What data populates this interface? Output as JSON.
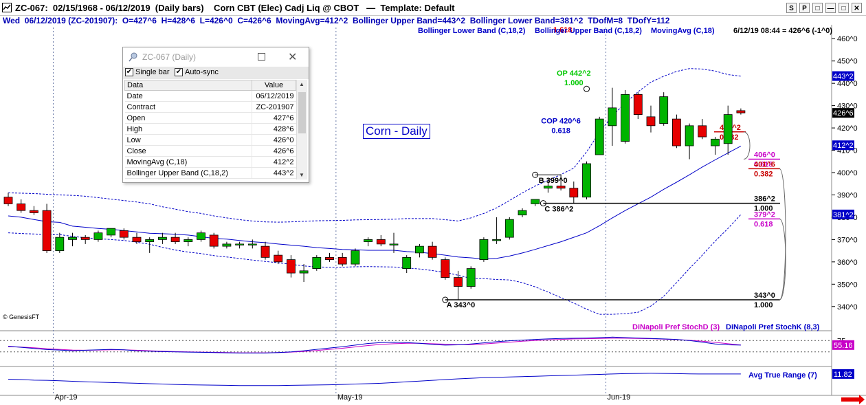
{
  "window": {
    "title": "ZC-067:  02/15/1968 - 06/12/2019  (Daily bars)    Corn CBT (Elec) Cadj Liq @ CBOT   —  Template: Default",
    "buttons": [
      "S",
      "P",
      "□",
      "—",
      "□",
      "✕"
    ]
  },
  "infobar": "Wed  06/12/2019 (ZC-201907):  O=427^6  H=428^6  L=426^0  C=426^6  MovingAvg=412^2  Bollinger Upper Band=443^2  Bollinger Lower Band=381^2  TDofM=8  TDofY=112",
  "legend": {
    "lower_band": "Bollinger Lower Band (C,18,2)",
    "upper_band": "Bollinger Upper Band (C,18,2)",
    "moving_avg": "MovingAvg (C,18)",
    "timestamp": "6/12/19 08:44 = 426^6 (-1^0)",
    "upper_band_overlap": "1.618"
  },
  "annotation": "Corn - Daily",
  "copyright": "© GenesisFT",
  "data_panel": {
    "title": "ZC-067 (Daily)",
    "single_bar_label": "Single bar",
    "auto_sync_label": "Auto-sync",
    "single_bar_checked": true,
    "auto_sync_checked": true,
    "header_label": "Data",
    "header_value": "Value",
    "rows": [
      {
        "label": "Date",
        "value": "06/12/2019"
      },
      {
        "label": "Contract",
        "value": "ZC-201907"
      },
      {
        "label": "Open",
        "value": "427^6"
      },
      {
        "label": "High",
        "value": "428^6"
      },
      {
        "label": "Low",
        "value": "426^0"
      },
      {
        "label": "Close",
        "value": "426^6"
      },
      {
        "label": "MovingAvg (C,18)",
        "value": "412^2"
      },
      {
        "label": "Bollinger Upper Band (C,18,2)",
        "value": "443^2"
      }
    ]
  },
  "price_axis": {
    "ticks": [
      "460^0",
      "450^0",
      "440^0",
      "430^0",
      "420^0",
      "410^0",
      "400^0",
      "390^0",
      "380^0",
      "370^0",
      "360^0",
      "350^0",
      "340^0"
    ],
    "markers": [
      {
        "label": "443^2",
        "value": 443.25,
        "color": "#0000c8"
      },
      {
        "label": "426^6",
        "value": 426.75,
        "color": "#000000"
      },
      {
        "label": "412^2",
        "value": 412.25,
        "color": "#0000c8"
      },
      {
        "label": "381^2",
        "value": 381.25,
        "color": "#0000c8"
      }
    ]
  },
  "x_axis": {
    "labels": [
      "Apr-19",
      "May-19",
      "Jun-19"
    ]
  },
  "chart_data": {
    "type": "candlestick",
    "title": "Corn CBT (Elec) Cadj Liq @ CBOT",
    "ylim": [
      335,
      465
    ],
    "x_labels": [
      "Apr-19",
      "May-19",
      "Jun-19"
    ],
    "candles": [
      {
        "o": 389,
        "h": 391,
        "l": 385,
        "c": 386
      },
      {
        "o": 386,
        "h": 388,
        "l": 382,
        "c": 383
      },
      {
        "o": 383,
        "h": 385,
        "l": 381,
        "c": 382
      },
      {
        "o": 383,
        "h": 386,
        "l": 364,
        "c": 365
      },
      {
        "o": 365,
        "h": 373,
        "l": 364,
        "c": 371
      },
      {
        "o": 370,
        "h": 373,
        "l": 367,
        "c": 371
      },
      {
        "o": 371,
        "h": 372,
        "l": 368,
        "c": 370
      },
      {
        "o": 370,
        "h": 374,
        "l": 369,
        "c": 373
      },
      {
        "o": 372,
        "h": 375,
        "l": 371,
        "c": 375
      },
      {
        "o": 374,
        "h": 375,
        "l": 370,
        "c": 371
      },
      {
        "o": 371,
        "h": 373,
        "l": 368,
        "c": 369
      },
      {
        "o": 369,
        "h": 371,
        "l": 364,
        "c": 370
      },
      {
        "o": 370,
        "h": 373,
        "l": 368,
        "c": 371
      },
      {
        "o": 371,
        "h": 373,
        "l": 368,
        "c": 369
      },
      {
        "o": 369,
        "h": 371,
        "l": 367,
        "c": 370
      },
      {
        "o": 370,
        "h": 374,
        "l": 369,
        "c": 373
      },
      {
        "o": 372,
        "h": 373,
        "l": 366,
        "c": 367
      },
      {
        "o": 367,
        "h": 369,
        "l": 366,
        "c": 368
      },
      {
        "o": 368,
        "h": 369,
        "l": 366,
        "c": 368
      },
      {
        "o": 368,
        "h": 370,
        "l": 366,
        "c": 368
      },
      {
        "o": 367,
        "h": 369,
        "l": 361,
        "c": 362
      },
      {
        "o": 363,
        "h": 365,
        "l": 359,
        "c": 360
      },
      {
        "o": 361,
        "h": 363,
        "l": 353,
        "c": 355
      },
      {
        "o": 355,
        "h": 359,
        "l": 351,
        "c": 356
      },
      {
        "o": 357,
        "h": 363,
        "l": 356,
        "c": 362
      },
      {
        "o": 362,
        "h": 364,
        "l": 360,
        "c": 361
      },
      {
        "o": 362,
        "h": 364,
        "l": 358,
        "c": 359
      },
      {
        "o": 359,
        "h": 366,
        "l": 358,
        "c": 365
      },
      {
        "o": 369,
        "h": 371,
        "l": 367,
        "c": 370
      },
      {
        "o": 370,
        "h": 372,
        "l": 367,
        "c": 368
      },
      {
        "o": 368,
        "h": 373,
        "l": 364,
        "c": 368
      },
      {
        "o": 357,
        "h": 363,
        "l": 355,
        "c": 362
      },
      {
        "o": 364,
        "h": 368,
        "l": 362,
        "c": 367
      },
      {
        "o": 367,
        "h": 369,
        "l": 361,
        "c": 362
      },
      {
        "o": 361,
        "h": 362,
        "l": 352,
        "c": 353
      },
      {
        "o": 353,
        "h": 356,
        "l": 343,
        "c": 349
      },
      {
        "o": 349,
        "h": 358,
        "l": 348,
        "c": 357
      },
      {
        "o": 361,
        "h": 371,
        "l": 360,
        "c": 370
      },
      {
        "o": 370,
        "h": 380,
        "l": 368,
        "c": 370
      },
      {
        "o": 371,
        "h": 380,
        "l": 370,
        "c": 379
      },
      {
        "o": 381,
        "h": 384,
        "l": 380,
        "c": 383
      },
      {
        "o": 386,
        "h": 387,
        "l": 385,
        "c": 388
      },
      {
        "o": 393,
        "h": 397,
        "l": 391,
        "c": 394
      },
      {
        "o": 394,
        "h": 399,
        "l": 392,
        "c": 393
      },
      {
        "o": 393,
        "h": 396,
        "l": 386,
        "c": 389
      },
      {
        "o": 389,
        "h": 405,
        "l": 388,
        "c": 404
      },
      {
        "o": 408,
        "h": 425,
        "l": 408,
        "c": 424
      },
      {
        "o": 421,
        "h": 438,
        "l": 412,
        "c": 429
      },
      {
        "o": 414,
        "h": 437,
        "l": 413,
        "c": 435
      },
      {
        "o": 435,
        "h": 436,
        "l": 424,
        "c": 426
      },
      {
        "o": 425,
        "h": 430,
        "l": 418,
        "c": 421
      },
      {
        "o": 422,
        "h": 436,
        "l": 421,
        "c": 434
      },
      {
        "o": 424,
        "h": 426,
        "l": 411,
        "c": 412
      },
      {
        "o": 412,
        "h": 422,
        "l": 406,
        "c": 421
      },
      {
        "o": 421,
        "h": 424,
        "l": 415,
        "c": 416
      },
      {
        "o": 412,
        "h": 416,
        "l": 408,
        "c": 415
      },
      {
        "o": 413,
        "h": 430,
        "l": 408,
        "c": 426
      },
      {
        "o": 427.75,
        "h": 428.75,
        "l": 426,
        "c": 426.75
      }
    ],
    "series": [
      {
        "name": "MovingAvg (C,18)",
        "values": [
          380.6,
          380,
          379,
          378,
          377.7,
          376,
          375.5,
          375,
          374.6,
          374,
          373.4,
          372.8,
          372.6,
          372.4,
          372,
          371.3,
          370.5,
          370.2,
          369.6,
          369,
          368.6,
          368,
          367.5,
          367,
          366.4,
          366,
          365.6,
          365.4,
          365.2,
          365.2,
          365.2,
          364.6,
          364.3,
          363.7,
          363,
          362.2,
          361.8,
          361.3,
          361.6,
          362.6,
          364,
          365.6,
          367.3,
          369,
          371,
          373,
          376.2,
          379.7,
          383,
          386,
          389,
          392.5,
          395.7,
          399,
          402.5,
          405.7,
          408.8,
          411.9
        ]
      },
      {
        "name": "Bollinger Upper Band (C,18,2)",
        "values": [
          390.9,
          390.8,
          390.6,
          390.3,
          390,
          389.8,
          389.4,
          388.8,
          388.1,
          387.5,
          386.8,
          386,
          384.7,
          383.6,
          382.5,
          381.7,
          380.6,
          379.7,
          378.9,
          378.3,
          377.9,
          377.8,
          377.9,
          378.2,
          378.4,
          378.5,
          378.6,
          378.8,
          378.9,
          379,
          379.1,
          379.4,
          379.4,
          379.4,
          378.9,
          378.3,
          379.7,
          381.7,
          384.2,
          387.5,
          390.9,
          394,
          396.5,
          399.1,
          402,
          409.3,
          418,
          425.4,
          431.1,
          436.2,
          440.5,
          443.2,
          445.3,
          446.6,
          446.4,
          445.5,
          443.9,
          443.2
        ]
      },
      {
        "name": "Bollinger Lower Band (C,18,2)",
        "values": [
          373,
          372.7,
          372.5,
          372.3,
          372.2,
          371.4,
          370.8,
          370.4,
          370,
          369.6,
          368.8,
          367.9,
          366.5,
          365.3,
          364.4,
          363.7,
          362.8,
          362.2,
          361.5,
          360.8,
          360.2,
          359.6,
          358.9,
          358.2,
          357.7,
          357.6,
          357.6,
          357.8,
          357.9,
          357.8,
          357.7,
          357.3,
          356.8,
          356.1,
          355.3,
          354,
          352.6,
          352.5,
          352.1,
          351.9,
          350.7,
          348.8,
          346.5,
          344,
          341.6,
          338.8,
          336.5,
          336.5,
          336.8,
          337.4,
          340.2,
          344.6,
          350.7,
          357,
          363,
          369.3,
          375,
          381.2
        ]
      }
    ],
    "dinapoli_levels": [
      {
        "label": "OP 442^2",
        "ratio": "1.000",
        "value": 442.25,
        "color": "#00c800"
      },
      {
        "label": "COP 420^6",
        "ratio": "0.618",
        "value": 420.75,
        "color": "#0000c8"
      },
      {
        "label": "B 399^0",
        "value": 399.0,
        "color": "#000000"
      },
      {
        "label": "C 386^2",
        "value": 386.25,
        "color": "#000000"
      },
      {
        "label": "A 343^0",
        "value": 343.0,
        "color": "#000000"
      }
    ],
    "retracements": [
      {
        "label": "418^2",
        "ratio": "0.382",
        "value": 418.25,
        "color": "#c80000"
      },
      {
        "label": "406^0",
        "ratio": "0.618",
        "value": 406.0,
        "color": "#c800c8"
      },
      {
        "label": "401^6",
        "ratio": "0.382",
        "value": 401.75,
        "color": "#c80000"
      },
      {
        "label": "386^2",
        "ratio": "1.000",
        "value": 386.25,
        "color": "#000000"
      },
      {
        "label": "379^2",
        "ratio": "0.618",
        "value": 379.25,
        "color": "#c800c8"
      },
      {
        "label": "343^0",
        "ratio": "1.000",
        "value": 343.0,
        "color": "#000000"
      }
    ],
    "stochastic": {
      "title_d": "DiNapoli Pref StochD (3)",
      "title_k": "DiNapoli Pref StochK (8,3)",
      "value_label": "55.16",
      "level_label": "75",
      "ylim": [
        0,
        100
      ],
      "levels": [
        75,
        25
      ],
      "k_values": [
        50,
        45,
        40,
        35,
        33,
        30,
        32,
        34,
        36,
        34,
        30,
        28,
        26,
        25,
        24,
        23,
        22,
        21,
        20,
        20,
        20,
        22,
        25,
        30,
        36,
        42,
        48,
        55,
        62,
        66,
        67,
        66,
        63,
        58,
        55,
        56,
        60,
        65,
        70,
        74,
        77,
        80,
        82,
        84,
        85,
        86,
        88,
        90,
        88,
        86,
        84,
        82,
        80,
        75,
        68,
        60,
        56,
        55
      ],
      "d_values": [
        48,
        46,
        43,
        39,
        36,
        33,
        32,
        33,
        34,
        34,
        32,
        30,
        28,
        26,
        25,
        24,
        23,
        22,
        21,
        21,
        21,
        22,
        24,
        27,
        31,
        36,
        41,
        47,
        53,
        58,
        61,
        63,
        63,
        61,
        59,
        57,
        57,
        60,
        64,
        68,
        72,
        75,
        78,
        80,
        82,
        83,
        84,
        85,
        85,
        84,
        83,
        81,
        79,
        76,
        72,
        67,
        61,
        55.16
      ],
      "colors": {
        "k": "#0000c8",
        "d": "#c800c8"
      }
    },
    "atr": {
      "title": "Avg True Range (7)",
      "value_label": "11.82",
      "ylim": [
        4,
        14
      ],
      "values": [
        9,
        8.8,
        8.5,
        8.4,
        8.2,
        7.9,
        7.6,
        7.4,
        7.2,
        7,
        6.8,
        6.6,
        6.4,
        6.2,
        6,
        5.9,
        5.8,
        5.7,
        5.6,
        5.6,
        5.6,
        5.6,
        5.7,
        5.8,
        5.9,
        6,
        6.2,
        6.4,
        6.6,
        6.8,
        7.2,
        7.6,
        8,
        8.4,
        8.8,
        9.2,
        9.5,
        9.8,
        10,
        10.2,
        10.4,
        10.6,
        10.8,
        11,
        11.2,
        11.4,
        11.6,
        11.8,
        12,
        12.1,
        12.2,
        12.1,
        12,
        11.9,
        11.8,
        11.8,
        11.8,
        11.82
      ],
      "color": "#0000c8"
    }
  }
}
